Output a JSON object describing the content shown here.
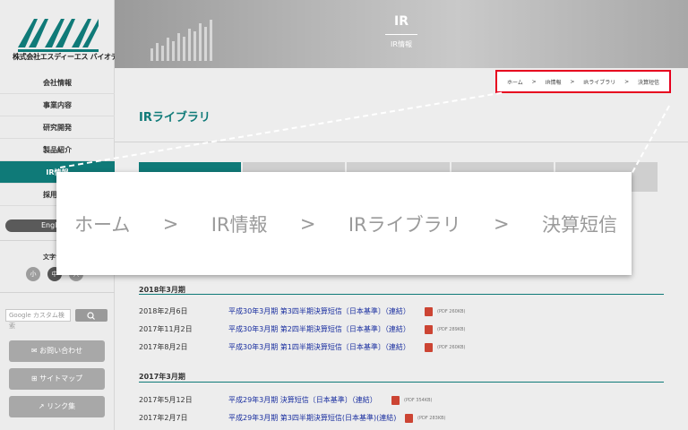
{
  "company": {
    "logo_text": "株式会社エスディーエス バイオテック"
  },
  "sidebar": {
    "nav": [
      {
        "label": "会社情報"
      },
      {
        "label": "事業内容"
      },
      {
        "label": "研究開発"
      },
      {
        "label": "製品紹介"
      },
      {
        "label": "IR情報"
      },
      {
        "label": "採用情報"
      }
    ],
    "lang_button": "English",
    "fontsize_label": "文字サイズ",
    "fontsize_buttons": [
      "小",
      "中",
      "大"
    ],
    "search_placeholder": "Google カスタム検索",
    "buttons": [
      {
        "label": "お問い合わせ",
        "icon": "mail-icon"
      },
      {
        "label": "サイトマップ",
        "icon": "sitemap-icon"
      },
      {
        "label": "リンク集",
        "icon": "external-link-icon"
      }
    ]
  },
  "hero": {
    "title": "IR",
    "subtitle": "IR情報"
  },
  "main": {
    "page_title": "IRライブラリ"
  },
  "breadcrumb": [
    "ホーム",
    ">",
    "IR情報",
    ">",
    "IRライブラリ",
    ">",
    "決算短信"
  ],
  "sections": [
    {
      "year": "2018年3月期",
      "rows": [
        {
          "date": "2018年2月6日",
          "title": "平成30年3月期 第3四半期決算短信〔日本基準〕（連結）",
          "size": "(PDF 260KB)"
        },
        {
          "date": "2017年11月2日",
          "title": "平成30年3月期 第2四半期決算短信〔日本基準〕（連結）",
          "size": "(PDF 289KB)"
        },
        {
          "date": "2017年8月2日",
          "title": "平成30年3月期 第1四半期決算短信〔日本基準〕（連結）",
          "size": "(PDF 260KB)"
        }
      ]
    },
    {
      "year": "2017年3月期",
      "rows": [
        {
          "date": "2017年5月12日",
          "title": "平成29年3月期 決算短信〔日本基準〕（連結）",
          "size": "(PDF 354KB)"
        },
        {
          "date": "2017年2月7日",
          "title": "平成29年3月期 第3四半期決算短信(日本基準)(連結)",
          "size": "(PDF 283KB)"
        }
      ]
    }
  ],
  "colors": {
    "accent": "#0f7a78",
    "highlight": "#e6001e",
    "link": "#1a2fa0"
  }
}
